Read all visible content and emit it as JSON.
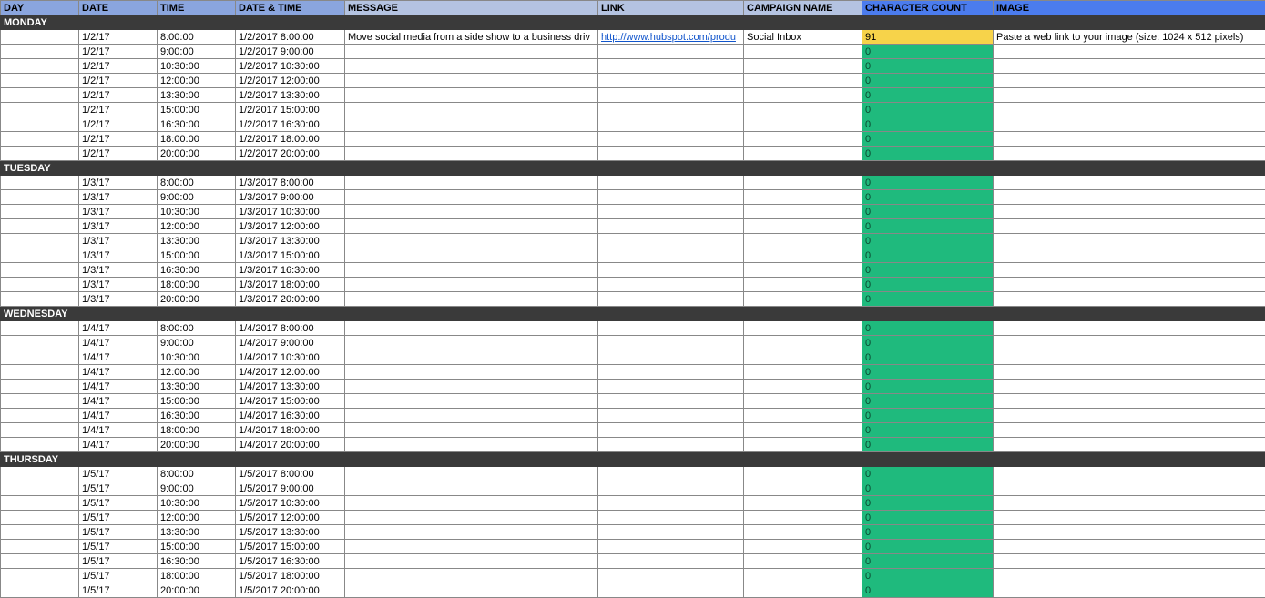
{
  "headers": {
    "day": "DAY",
    "date": "DATE",
    "time": "TIME",
    "datetime": "DATE & TIME",
    "message": "MESSAGE",
    "link": "LINK",
    "campaign": "CAMPAIGN NAME",
    "count": "CHARACTER COUNT",
    "image": "IMAGE"
  },
  "days": [
    {
      "label": "MONDAY",
      "rows": [
        {
          "date": "1/2/17",
          "time": "8:00:00",
          "datetime": "1/2/2017 8:00:00",
          "message": "Move social media from a side show to a business driv",
          "link": "http://www.hubspot.com/produ",
          "campaign": "Social Inbox",
          "count": "91",
          "countClass": "count-yellow",
          "image": "Paste a web link to your image (size: 1024 x 512 pixels)"
        },
        {
          "date": "1/2/17",
          "time": "9:00:00",
          "datetime": "1/2/2017 9:00:00",
          "message": "",
          "link": "",
          "campaign": "",
          "count": "0",
          "countClass": "count-green",
          "image": ""
        },
        {
          "date": "1/2/17",
          "time": "10:30:00",
          "datetime": "1/2/2017 10:30:00",
          "message": "",
          "link": "",
          "campaign": "",
          "count": "0",
          "countClass": "count-green",
          "image": ""
        },
        {
          "date": "1/2/17",
          "time": "12:00:00",
          "datetime": "1/2/2017 12:00:00",
          "message": "",
          "link": "",
          "campaign": "",
          "count": "0",
          "countClass": "count-green",
          "image": ""
        },
        {
          "date": "1/2/17",
          "time": "13:30:00",
          "datetime": "1/2/2017 13:30:00",
          "message": "",
          "link": "",
          "campaign": "",
          "count": "0",
          "countClass": "count-green",
          "image": ""
        },
        {
          "date": "1/2/17",
          "time": "15:00:00",
          "datetime": "1/2/2017 15:00:00",
          "message": "",
          "link": "",
          "campaign": "",
          "count": "0",
          "countClass": "count-green",
          "image": ""
        },
        {
          "date": "1/2/17",
          "time": "16:30:00",
          "datetime": "1/2/2017 16:30:00",
          "message": "",
          "link": "",
          "campaign": "",
          "count": "0",
          "countClass": "count-green",
          "image": ""
        },
        {
          "date": "1/2/17",
          "time": "18:00:00",
          "datetime": "1/2/2017 18:00:00",
          "message": "",
          "link": "",
          "campaign": "",
          "count": "0",
          "countClass": "count-green",
          "image": ""
        },
        {
          "date": "1/2/17",
          "time": "20:00:00",
          "datetime": "1/2/2017 20:00:00",
          "message": "",
          "link": "",
          "campaign": "",
          "count": "0",
          "countClass": "count-green",
          "image": ""
        }
      ]
    },
    {
      "label": "TUESDAY",
      "rows": [
        {
          "date": "1/3/17",
          "time": "8:00:00",
          "datetime": "1/3/2017 8:00:00",
          "message": "",
          "link": "",
          "campaign": "",
          "count": "0",
          "countClass": "count-green",
          "image": ""
        },
        {
          "date": "1/3/17",
          "time": "9:00:00",
          "datetime": "1/3/2017 9:00:00",
          "message": "",
          "link": "",
          "campaign": "",
          "count": "0",
          "countClass": "count-green",
          "image": ""
        },
        {
          "date": "1/3/17",
          "time": "10:30:00",
          "datetime": "1/3/2017 10:30:00",
          "message": "",
          "link": "",
          "campaign": "",
          "count": "0",
          "countClass": "count-green",
          "image": ""
        },
        {
          "date": "1/3/17",
          "time": "12:00:00",
          "datetime": "1/3/2017 12:00:00",
          "message": "",
          "link": "",
          "campaign": "",
          "count": "0",
          "countClass": "count-green",
          "image": ""
        },
        {
          "date": "1/3/17",
          "time": "13:30:00",
          "datetime": "1/3/2017 13:30:00",
          "message": "",
          "link": "",
          "campaign": "",
          "count": "0",
          "countClass": "count-green",
          "image": ""
        },
        {
          "date": "1/3/17",
          "time": "15:00:00",
          "datetime": "1/3/2017 15:00:00",
          "message": "",
          "link": "",
          "campaign": "",
          "count": "0",
          "countClass": "count-green",
          "image": ""
        },
        {
          "date": "1/3/17",
          "time": "16:30:00",
          "datetime": "1/3/2017 16:30:00",
          "message": "",
          "link": "",
          "campaign": "",
          "count": "0",
          "countClass": "count-green",
          "image": ""
        },
        {
          "date": "1/3/17",
          "time": "18:00:00",
          "datetime": "1/3/2017 18:00:00",
          "message": "",
          "link": "",
          "campaign": "",
          "count": "0",
          "countClass": "count-green",
          "image": ""
        },
        {
          "date": "1/3/17",
          "time": "20:00:00",
          "datetime": "1/3/2017 20:00:00",
          "message": "",
          "link": "",
          "campaign": "",
          "count": "0",
          "countClass": "count-green",
          "image": ""
        }
      ]
    },
    {
      "label": "WEDNESDAY",
      "rows": [
        {
          "date": "1/4/17",
          "time": "8:00:00",
          "datetime": "1/4/2017 8:00:00",
          "message": "",
          "link": "",
          "campaign": "",
          "count": "0",
          "countClass": "count-green",
          "image": ""
        },
        {
          "date": "1/4/17",
          "time": "9:00:00",
          "datetime": "1/4/2017 9:00:00",
          "message": "",
          "link": "",
          "campaign": "",
          "count": "0",
          "countClass": "count-green",
          "image": ""
        },
        {
          "date": "1/4/17",
          "time": "10:30:00",
          "datetime": "1/4/2017 10:30:00",
          "message": "",
          "link": "",
          "campaign": "",
          "count": "0",
          "countClass": "count-green",
          "image": ""
        },
        {
          "date": "1/4/17",
          "time": "12:00:00",
          "datetime": "1/4/2017 12:00:00",
          "message": "",
          "link": "",
          "campaign": "",
          "count": "0",
          "countClass": "count-green",
          "image": ""
        },
        {
          "date": "1/4/17",
          "time": "13:30:00",
          "datetime": "1/4/2017 13:30:00",
          "message": "",
          "link": "",
          "campaign": "",
          "count": "0",
          "countClass": "count-green",
          "image": ""
        },
        {
          "date": "1/4/17",
          "time": "15:00:00",
          "datetime": "1/4/2017 15:00:00",
          "message": "",
          "link": "",
          "campaign": "",
          "count": "0",
          "countClass": "count-green",
          "image": ""
        },
        {
          "date": "1/4/17",
          "time": "16:30:00",
          "datetime": "1/4/2017 16:30:00",
          "message": "",
          "link": "",
          "campaign": "",
          "count": "0",
          "countClass": "count-green",
          "image": ""
        },
        {
          "date": "1/4/17",
          "time": "18:00:00",
          "datetime": "1/4/2017 18:00:00",
          "message": "",
          "link": "",
          "campaign": "",
          "count": "0",
          "countClass": "count-green",
          "image": ""
        },
        {
          "date": "1/4/17",
          "time": "20:00:00",
          "datetime": "1/4/2017 20:00:00",
          "message": "",
          "link": "",
          "campaign": "",
          "count": "0",
          "countClass": "count-green",
          "image": ""
        }
      ]
    },
    {
      "label": "THURSDAY",
      "rows": [
        {
          "date": "1/5/17",
          "time": "8:00:00",
          "datetime": "1/5/2017 8:00:00",
          "message": "",
          "link": "",
          "campaign": "",
          "count": "0",
          "countClass": "count-green",
          "image": ""
        },
        {
          "date": "1/5/17",
          "time": "9:00:00",
          "datetime": "1/5/2017 9:00:00",
          "message": "",
          "link": "",
          "campaign": "",
          "count": "0",
          "countClass": "count-green",
          "image": ""
        },
        {
          "date": "1/5/17",
          "time": "10:30:00",
          "datetime": "1/5/2017 10:30:00",
          "message": "",
          "link": "",
          "campaign": "",
          "count": "0",
          "countClass": "count-green",
          "image": ""
        },
        {
          "date": "1/5/17",
          "time": "12:00:00",
          "datetime": "1/5/2017 12:00:00",
          "message": "",
          "link": "",
          "campaign": "",
          "count": "0",
          "countClass": "count-green",
          "image": ""
        },
        {
          "date": "1/5/17",
          "time": "13:30:00",
          "datetime": "1/5/2017 13:30:00",
          "message": "",
          "link": "",
          "campaign": "",
          "count": "0",
          "countClass": "count-green",
          "image": ""
        },
        {
          "date": "1/5/17",
          "time": "15:00:00",
          "datetime": "1/5/2017 15:00:00",
          "message": "",
          "link": "",
          "campaign": "",
          "count": "0",
          "countClass": "count-green",
          "image": ""
        },
        {
          "date": "1/5/17",
          "time": "16:30:00",
          "datetime": "1/5/2017 16:30:00",
          "message": "",
          "link": "",
          "campaign": "",
          "count": "0",
          "countClass": "count-green",
          "image": ""
        },
        {
          "date": "1/5/17",
          "time": "18:00:00",
          "datetime": "1/5/2017 18:00:00",
          "message": "",
          "link": "",
          "campaign": "",
          "count": "0",
          "countClass": "count-green",
          "image": ""
        },
        {
          "date": "1/5/17",
          "time": "20:00:00",
          "datetime": "1/5/2017 20:00:00",
          "message": "",
          "link": "",
          "campaign": "",
          "count": "0",
          "countClass": "count-green",
          "image": ""
        }
      ]
    }
  ]
}
